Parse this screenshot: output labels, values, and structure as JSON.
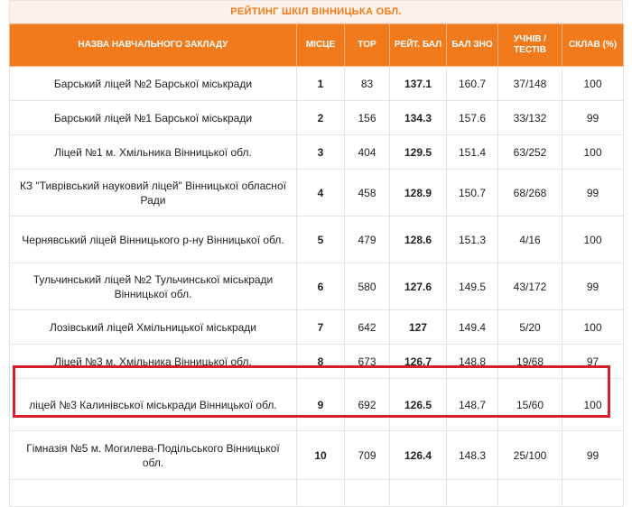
{
  "title": "РЕЙТИНГ ШКІЛ ВІННИЦЬКА ОБЛ.",
  "columns": [
    "НАЗВА НАВЧАЛЬНОГО ЗАКЛАДУ",
    "МІСЦЕ",
    "ТОР",
    "РЕЙТ. БАЛ",
    "БАЛ ЗНО",
    "УЧНІВ / ТЕСТІВ",
    "СКЛАВ (%)"
  ],
  "rows": [
    {
      "name": "Барський ліцей №2 Барської міськради",
      "place": "1",
      "top": "83",
      "rating": "137.1",
      "zno": "160.7",
      "students": "37/148",
      "passed": "100"
    },
    {
      "name": "Барський ліцей №1 Барської міськради",
      "place": "2",
      "top": "156",
      "rating": "134.3",
      "zno": "157.6",
      "students": "33/132",
      "passed": "99"
    },
    {
      "name": "Ліцей №1 м. Хмільника Вінницької обл.",
      "place": "3",
      "top": "404",
      "rating": "129.5",
      "zno": "151.4",
      "students": "63/252",
      "passed": "100"
    },
    {
      "name": "КЗ \"Тиврівський науковий ліцей\" Вінницької обласної Ради",
      "place": "4",
      "top": "458",
      "rating": "128.9",
      "zno": "150.7",
      "students": "68/268",
      "passed": "99"
    },
    {
      "name": "Чернявський ліцей Вінницького р-ну Вінницької обл.",
      "place": "5",
      "top": "479",
      "rating": "128.6",
      "zno": "151.3",
      "students": "4/16",
      "passed": "100"
    },
    {
      "name": "Тульчинський ліцей №2 Тульчинської міськради Вінницької обл.",
      "place": "6",
      "top": "580",
      "rating": "127.6",
      "zno": "149.5",
      "students": "43/172",
      "passed": "99"
    },
    {
      "name": "Лозівський ліцей Хмільницької міськради",
      "place": "7",
      "top": "642",
      "rating": "127",
      "zno": "149.4",
      "students": "5/20",
      "passed": "100"
    },
    {
      "name": "Ліцей №3 м. Хмільника Вінницької обл.",
      "place": "8",
      "top": "673",
      "rating": "126.7",
      "zno": "148.8",
      "students": "19/68",
      "passed": "97"
    },
    {
      "name": "ліцей №3 Калинівської міськради Вінницької обл.",
      "place": "9",
      "top": "692",
      "rating": "126.5",
      "zno": "148.7",
      "students": "15/60",
      "passed": "100"
    },
    {
      "name": "Гімназія №5 м. Могилева-Подільського Вінницької обл.",
      "place": "10",
      "top": "709",
      "rating": "126.4",
      "zno": "148.3",
      "students": "25/100",
      "passed": "99"
    },
    {
      "name": "",
      "place": "",
      "top": "",
      "rating": "",
      "zno": "",
      "students": "",
      "passed": ""
    }
  ],
  "colors": {
    "header": "#f07a1c",
    "title_text": "#f07a1c",
    "highlight": "#d3202a"
  },
  "highlighted_row": "9"
}
